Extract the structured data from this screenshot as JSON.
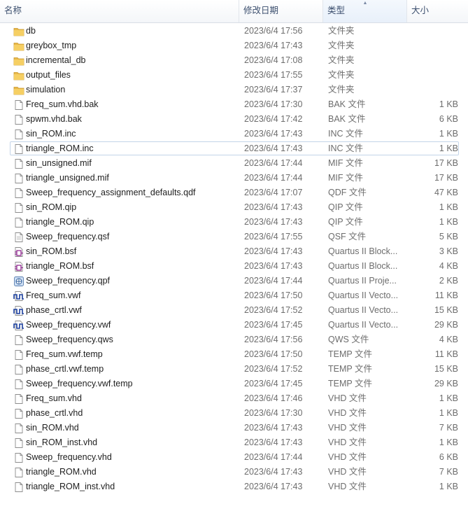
{
  "columns": {
    "name": "名称",
    "modified": "修改日期",
    "type": "类型",
    "size": "大小"
  },
  "files": [
    {
      "name": "db",
      "modified": "2023/6/4 17:56",
      "type": "文件夹",
      "size": "",
      "icon": "folder-icon"
    },
    {
      "name": "greybox_tmp",
      "modified": "2023/6/4 17:43",
      "type": "文件夹",
      "size": "",
      "icon": "folder-icon"
    },
    {
      "name": "incremental_db",
      "modified": "2023/6/4 17:08",
      "type": "文件夹",
      "size": "",
      "icon": "folder-icon"
    },
    {
      "name": "output_files",
      "modified": "2023/6/4 17:55",
      "type": "文件夹",
      "size": "",
      "icon": "folder-icon"
    },
    {
      "name": "simulation",
      "modified": "2023/6/4 17:37",
      "type": "文件夹",
      "size": "",
      "icon": "folder-icon"
    },
    {
      "name": "Freq_sum.vhd.bak",
      "modified": "2023/6/4 17:30",
      "type": "BAK 文件",
      "size": "1 KB",
      "icon": "file-icon"
    },
    {
      "name": "spwm.vhd.bak",
      "modified": "2023/6/4 17:42",
      "type": "BAK 文件",
      "size": "6 KB",
      "icon": "file-icon"
    },
    {
      "name": "sin_ROM.inc",
      "modified": "2023/6/4 17:43",
      "type": "INC 文件",
      "size": "1 KB",
      "icon": "file-icon"
    },
    {
      "name": "triangle_ROM.inc",
      "modified": "2023/6/4 17:43",
      "type": "INC 文件",
      "size": "1 KB",
      "icon": "file-icon",
      "selected": true
    },
    {
      "name": "sin_unsigned.mif",
      "modified": "2023/6/4 17:44",
      "type": "MIF 文件",
      "size": "17 KB",
      "icon": "file-icon"
    },
    {
      "name": "triangle_unsigned.mif",
      "modified": "2023/6/4 17:44",
      "type": "MIF 文件",
      "size": "17 KB",
      "icon": "file-icon"
    },
    {
      "name": "Sweep_frequency_assignment_defaults.qdf",
      "modified": "2023/6/4 17:07",
      "type": "QDF 文件",
      "size": "47 KB",
      "icon": "file-icon"
    },
    {
      "name": "sin_ROM.qip",
      "modified": "2023/6/4 17:43",
      "type": "QIP 文件",
      "size": "1 KB",
      "icon": "file-icon"
    },
    {
      "name": "triangle_ROM.qip",
      "modified": "2023/6/4 17:43",
      "type": "QIP 文件",
      "size": "1 KB",
      "icon": "file-icon"
    },
    {
      "name": "Sweep_frequency.qsf",
      "modified": "2023/6/4 17:55",
      "type": "QSF 文件",
      "size": "5 KB",
      "icon": "file-lines-icon"
    },
    {
      "name": "sin_ROM.bsf",
      "modified": "2023/6/4 17:43",
      "type": "Quartus II Block...",
      "size": "3 KB",
      "icon": "block-symbol-icon"
    },
    {
      "name": "triangle_ROM.bsf",
      "modified": "2023/6/4 17:43",
      "type": "Quartus II Block...",
      "size": "4 KB",
      "icon": "block-symbol-icon"
    },
    {
      "name": "Sweep_frequency.qpf",
      "modified": "2023/6/4 17:44",
      "type": "Quartus II Proje...",
      "size": "2 KB",
      "icon": "project-icon"
    },
    {
      "name": "Freq_sum.vwf",
      "modified": "2023/6/4 17:50",
      "type": "Quartus II Vecto...",
      "size": "11 KB",
      "icon": "waveform-icon"
    },
    {
      "name": "phase_crtl.vwf",
      "modified": "2023/6/4 17:52",
      "type": "Quartus II Vecto...",
      "size": "15 KB",
      "icon": "waveform-icon"
    },
    {
      "name": "Sweep_frequency.vwf",
      "modified": "2023/6/4 17:45",
      "type": "Quartus II Vecto...",
      "size": "29 KB",
      "icon": "waveform-icon"
    },
    {
      "name": "Sweep_frequency.qws",
      "modified": "2023/6/4 17:56",
      "type": "QWS 文件",
      "size": "4 KB",
      "icon": "file-icon"
    },
    {
      "name": "Freq_sum.vwf.temp",
      "modified": "2023/6/4 17:50",
      "type": "TEMP 文件",
      "size": "11 KB",
      "icon": "file-icon"
    },
    {
      "name": "phase_crtl.vwf.temp",
      "modified": "2023/6/4 17:52",
      "type": "TEMP 文件",
      "size": "15 KB",
      "icon": "file-icon"
    },
    {
      "name": "Sweep_frequency.vwf.temp",
      "modified": "2023/6/4 17:45",
      "type": "TEMP 文件",
      "size": "29 KB",
      "icon": "file-icon"
    },
    {
      "name": "Freq_sum.vhd",
      "modified": "2023/6/4 17:46",
      "type": "VHD 文件",
      "size": "1 KB",
      "icon": "file-icon"
    },
    {
      "name": "phase_crtl.vhd",
      "modified": "2023/6/4 17:30",
      "type": "VHD 文件",
      "size": "1 KB",
      "icon": "file-icon"
    },
    {
      "name": "sin_ROM.vhd",
      "modified": "2023/6/4 17:43",
      "type": "VHD 文件",
      "size": "7 KB",
      "icon": "file-icon"
    },
    {
      "name": "sin_ROM_inst.vhd",
      "modified": "2023/6/4 17:43",
      "type": "VHD 文件",
      "size": "1 KB",
      "icon": "file-icon"
    },
    {
      "name": "Sweep_frequency.vhd",
      "modified": "2023/6/4 17:44",
      "type": "VHD 文件",
      "size": "6 KB",
      "icon": "file-icon"
    },
    {
      "name": "triangle_ROM.vhd",
      "modified": "2023/6/4 17:43",
      "type": "VHD 文件",
      "size": "7 KB",
      "icon": "file-icon"
    },
    {
      "name": "triangle_ROM_inst.vhd",
      "modified": "2023/6/4 17:43",
      "type": "VHD 文件",
      "size": "1 KB",
      "icon": "file-icon"
    }
  ]
}
